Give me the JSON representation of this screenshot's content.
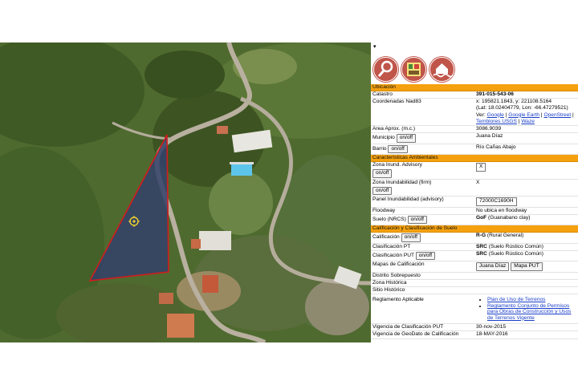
{
  "panel": {
    "dropdown_icon": "▾",
    "logos": [
      "gis-logo-icon",
      "crim-logo-icon",
      "flood-logo-icon"
    ],
    "sections": {
      "ubicacion": "Ubicación",
      "ambientales": "Características Ambientales",
      "calificacion": "Calificación y Clasificación de Suelo"
    },
    "catastro": {
      "label": "Catastro",
      "value": "391-015-543-06"
    },
    "coordenadas": {
      "label": "Coordenadas Nad83",
      "line1": "x: 195821.1843, y: 221108.5164",
      "line2": "(Lat: 18.02404779, Lon: -66.47279521)",
      "ver": "Ver:",
      "links": [
        "Google",
        "Google Earth",
        "OpenStreet",
        "Temblores USGS",
        "Waze"
      ]
    },
    "area": {
      "label": "Area Aprox. (m.c.)",
      "value": "3086.9039"
    },
    "municipio": {
      "label": "Municipio",
      "button": "on/off",
      "value": "Juana Díaz"
    },
    "barrio": {
      "label": "Barrio",
      "button": "on/off",
      "value": "Río Cañas Abajo"
    },
    "advisory": {
      "label": "Zona Inund. Advisory",
      "button": "on/off",
      "value": "X"
    },
    "firm": {
      "label": "Zona Inundabilidad (firm)",
      "button": "on/off",
      "value": "X"
    },
    "panel_inund": {
      "label": "Panel Inundabilidad (advisory)",
      "value": "72000C1690H"
    },
    "floodway": {
      "label": "Floodway",
      "value": "No ubica en floodway"
    },
    "suelo": {
      "label": "Suelo (NRCS)",
      "button": "on/off",
      "value_bold": "GoF",
      "value": " (Guanabano clay)"
    },
    "calif": {
      "label": "Calificación",
      "button": "on/off",
      "value_bold": "R-G",
      "value": " (Rural General)"
    },
    "clas_pt": {
      "label": "Clasificación PT",
      "value_bold": "SRC",
      "value": " (Suelo Rústico Común)"
    },
    "clas_put": {
      "label": "Clasificación PUT",
      "button": "on/off",
      "value_bold": "SRC",
      "value": " (Suelo Rústico Común)"
    },
    "mapas": {
      "label": "Mapas de Calificación",
      "buttons": [
        "Juana Díaz",
        "Mapa PUT"
      ]
    },
    "distrito": {
      "label": "Distrito Sobrepuesto",
      "value": ""
    },
    "zona_hist": {
      "label": "Zona Histórica",
      "value": ""
    },
    "sitio_hist": {
      "label": "Sitio Histórico",
      "value": ""
    },
    "reglamento": {
      "label": "Reglamento Aplicable",
      "links": [
        "Plan de Uso de Terrenos",
        "Reglamento Conjunto de Permisos para Obras de Construcción y Usos de Terrenos Vigente"
      ]
    },
    "vig_clas": {
      "label": "Vigencia de Clasificación PUT",
      "value": "30-nov-2015"
    },
    "vig_geo": {
      "label": "Vigencia de GeoDato de Calificación",
      "value": "18-MAY-2016"
    }
  },
  "colors": {
    "section_bar": "#f5a10f",
    "parcel_outline": "#d21c1c",
    "link": "#1a3ec9"
  }
}
